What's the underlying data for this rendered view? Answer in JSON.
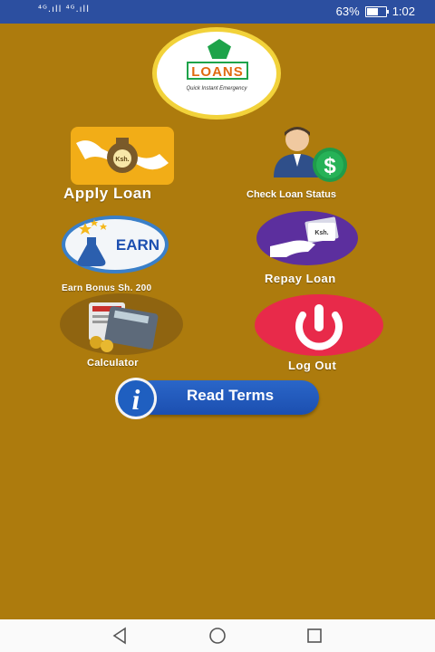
{
  "status_bar": {
    "signal": "⁴ᴳ.ıll ⁴ᴳ.ıll",
    "battery": "63%",
    "time": "1:02"
  },
  "logo": {
    "word": "LOANS",
    "tagline": "Quick Instant Emergency"
  },
  "menu": {
    "apply_loan": "Apply Loan",
    "check_status": "Check Loan Status",
    "earn_bonus": "Earn Bonus Sh. 200",
    "repay_loan": "Repay Loan",
    "calculator": "Calculator",
    "log_out": "Log Out",
    "read_terms": "Read Terms"
  },
  "icon_text": {
    "currency": "Ksh.",
    "earn": "EARN",
    "dollar": "$",
    "info": "i"
  },
  "colors": {
    "background": "#ad7b0d",
    "status_bar": "#2c4fa0",
    "accent_blue": "#1c4fb0"
  }
}
